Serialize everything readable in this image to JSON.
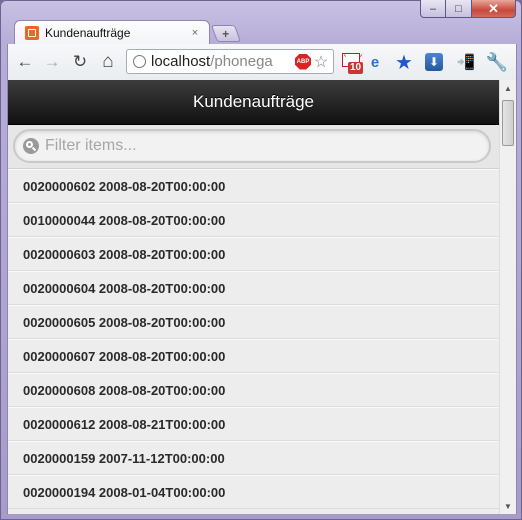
{
  "tab": {
    "title": "Kundenaufträge",
    "close_glyph": "×"
  },
  "new_tab_glyph": "+",
  "window_controls": {
    "minimize": "–",
    "maximize": "□",
    "close": "✕"
  },
  "toolbar": {
    "back": "←",
    "forward": "→",
    "reload": "↻",
    "home": "⌂",
    "url_host": "localhost",
    "url_path": "/phonega",
    "abp_label": "ABP",
    "bookmark_star": "☆",
    "gmail_count": "10",
    "ie_label": "e",
    "blue_star": "★",
    "download": "⬇",
    "phone": "📲",
    "wrench": "🔧"
  },
  "header": {
    "title": "Kundenaufträge"
  },
  "filter": {
    "placeholder": "Filter items..."
  },
  "items": [
    "0020000602 2008-08-20T00:00:00",
    "0010000044 2008-08-20T00:00:00",
    "0020000603 2008-08-20T00:00:00",
    "0020000604 2008-08-20T00:00:00",
    "0020000605 2008-08-20T00:00:00",
    "0020000607 2008-08-20T00:00:00",
    "0020000608 2008-08-20T00:00:00",
    "0020000612 2008-08-21T00:00:00",
    "0020000159 2007-11-12T00:00:00",
    "0020000194 2008-01-04T00:00:00"
  ],
  "scrollbar": {
    "up": "▲",
    "down": "▼"
  }
}
